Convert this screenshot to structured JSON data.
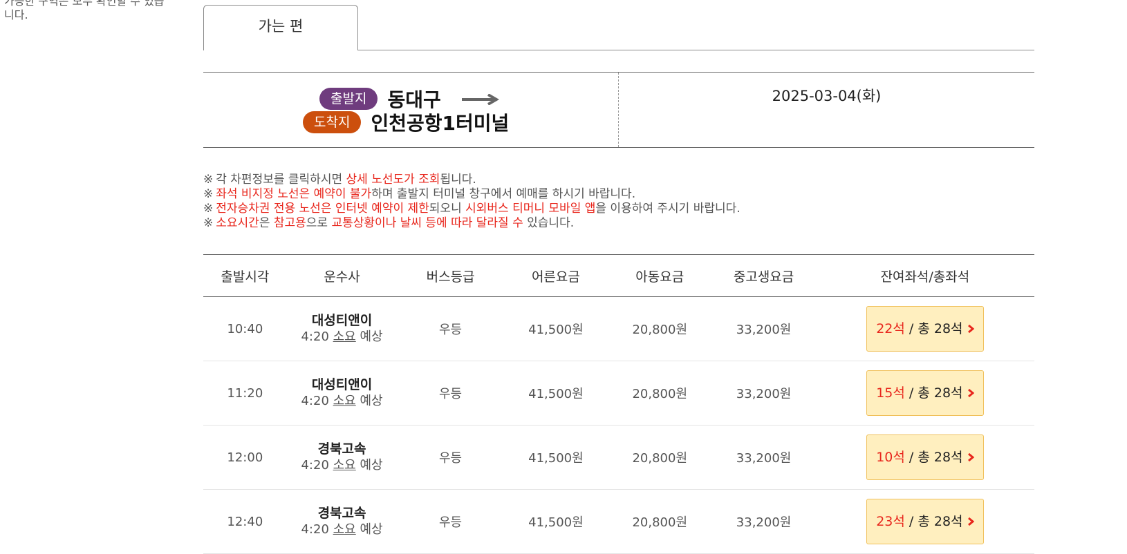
{
  "side_text": "가능한 구역은 모두 확인할 수 있습니다.",
  "tab": {
    "label": "가는 편"
  },
  "route": {
    "departure_badge": "출발지",
    "departure": "동대구",
    "arrival_badge": "도착지",
    "arrival": "인천공항1터미널",
    "date": "2025-03-04(화)"
  },
  "notes": [
    [
      {
        "t": "각 차편정보를 클릭하시면 "
      },
      {
        "t": "상세 노선도가 조회",
        "hl": true
      },
      {
        "t": "됩니다."
      }
    ],
    [
      {
        "t": "좌석 비지정 노선은 예약이 불가",
        "hl": true
      },
      {
        "t": "하며 출발지 터미널 창구에서 예매를 하시기 바랍니다."
      }
    ],
    [
      {
        "t": "전자승차권 전용 노선은 인터넷 예약이 제한",
        "hl": true
      },
      {
        "t": "되오니 "
      },
      {
        "t": "시외버스 티머니 모바일 앱",
        "hl": true
      },
      {
        "t": "을 이용하여 주시기 바랍니다."
      }
    ],
    [
      {
        "t": "소요시간",
        "hl": true
      },
      {
        "t": "은 "
      },
      {
        "t": "참고용",
        "hl": true
      },
      {
        "t": "으로 "
      },
      {
        "t": "교통상황이나 날씨 등에 따라 달라질 수",
        "hl": true
      },
      {
        "t": " 있습니다."
      }
    ]
  ],
  "note_mark": "※",
  "table": {
    "headers": [
      "출발시각",
      "운수사",
      "버스등급",
      "어른요금",
      "아동요금",
      "중고생요금",
      "잔여좌석/총좌석"
    ],
    "rows": [
      {
        "time": "10:40",
        "company": "대성티앤이",
        "dur_time": "4:20",
        "dur_mid": "소요",
        "dur_end": "예상",
        "grade": "우등",
        "adult": "41,500원",
        "child": "20,800원",
        "teen": "33,200원",
        "remain": "22석",
        "total": "/ 총 28석"
      },
      {
        "time": "11:20",
        "company": "대성티앤이",
        "dur_time": "4:20",
        "dur_mid": "소요",
        "dur_end": "예상",
        "grade": "우등",
        "adult": "41,500원",
        "child": "20,800원",
        "teen": "33,200원",
        "remain": "15석",
        "total": "/ 총 28석"
      },
      {
        "time": "12:00",
        "company": "경북고속",
        "dur_time": "4:20",
        "dur_mid": "소요",
        "dur_end": "예상",
        "grade": "우등",
        "adult": "41,500원",
        "child": "20,800원",
        "teen": "33,200원",
        "remain": "10석",
        "total": "/ 총 28석"
      },
      {
        "time": "12:40",
        "company": "경북고속",
        "dur_time": "4:20",
        "dur_mid": "소요",
        "dur_end": "예상",
        "grade": "우등",
        "adult": "41,500원",
        "child": "20,800원",
        "teen": "33,200원",
        "remain": "23석",
        "total": "/ 총 28석"
      }
    ]
  },
  "colors": {
    "departure_badge": "#6f3c7e",
    "arrival_badge": "#cc4f0d",
    "highlight": "#e8261c",
    "seat_button": "#ffefbf"
  }
}
